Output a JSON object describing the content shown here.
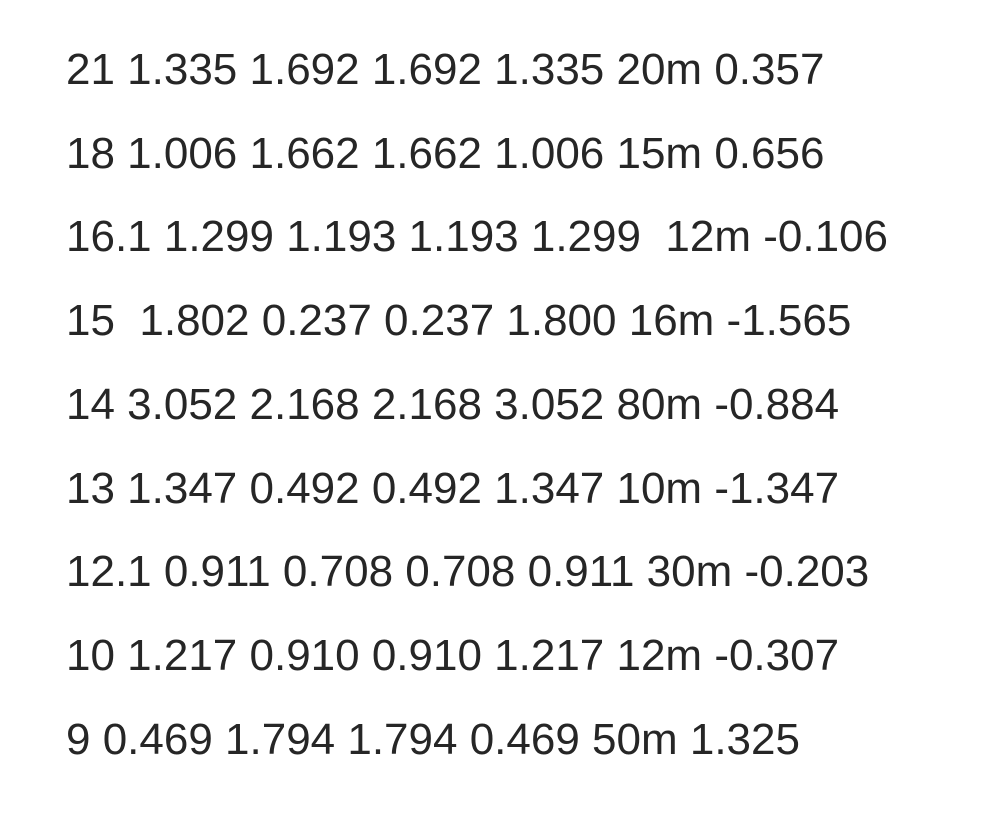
{
  "lines": [
    "21 1.335 1.692 1.692 1.335 20m 0.357",
    "18 1.006 1.662 1.662 1.006 15m 0.656",
    "16.1 1.299 1.193 1.193 1.299  12m -0.106",
    "15  1.802 0.237 0.237 1.800 16m -1.565",
    "14 3.052 2.168 2.168 3.052 80m -0.884",
    "13 1.347 0.492 0.492 1.347 10m -1.347",
    "12.1 0.911 0.708 0.708 0.911 30m -0.203",
    "10 1.217 0.910 0.910 1.217 12m -0.307",
    "9 0.469 1.794 1.794 0.469 50m 1.325"
  ]
}
